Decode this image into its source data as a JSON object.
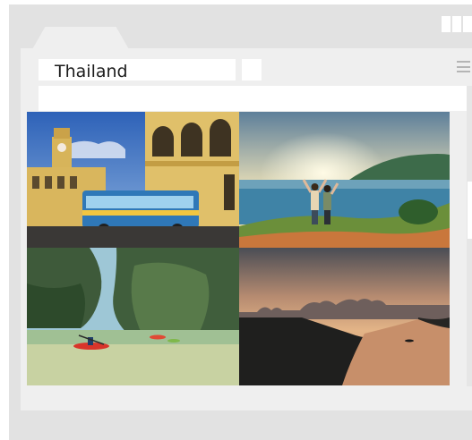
{
  "address_bar": {
    "text": "Thailand"
  },
  "photos": [
    {
      "icon": "phuket-old-town-photo"
    },
    {
      "icon": "couple-viewpoint-photo"
    },
    {
      "icon": "kayak-lagoon-photo"
    },
    {
      "icon": "river-sunset-photo"
    }
  ]
}
